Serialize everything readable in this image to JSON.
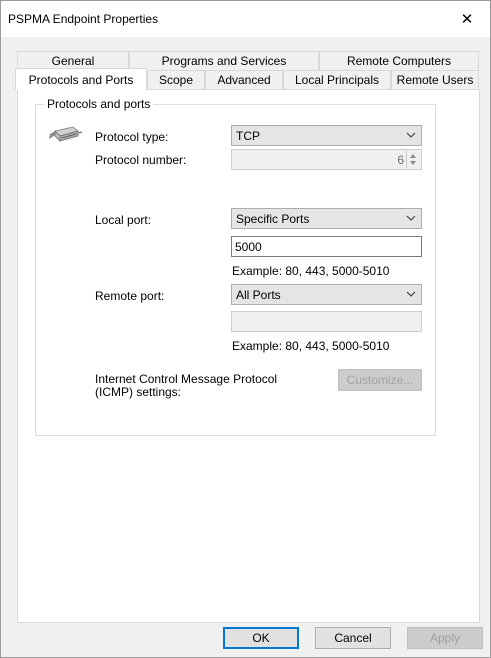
{
  "window": {
    "title": "PSPMA Endpoint Properties",
    "close_glyph": "✕"
  },
  "tabs": {
    "row1": [
      "General",
      "Programs and Services",
      "Remote Computers"
    ],
    "row2": [
      "Protocols and Ports",
      "Scope",
      "Advanced",
      "Local Principals",
      "Remote Users"
    ],
    "active": "Protocols and Ports"
  },
  "group": {
    "title": "Protocols and ports",
    "protocol_type_label": "Protocol type:",
    "protocol_type_value": "TCP",
    "protocol_number_label": "Protocol number:",
    "protocol_number_value": "6",
    "local_port_label": "Local port:",
    "local_port_value": "Specific Ports",
    "local_port_text": "5000",
    "local_example": "Example: 80, 443, 5000-5010",
    "remote_port_label": "Remote port:",
    "remote_port_value": "All Ports",
    "remote_port_text": "",
    "remote_example": "Example: 80, 443, 5000-5010",
    "icmp_label_line1": "Internet Control Message Protocol",
    "icmp_label_line2": "(ICMP) settings:",
    "customize_button": "Customize..."
  },
  "footer": {
    "ok": "OK",
    "cancel": "Cancel",
    "apply": "Apply"
  },
  "icons": {
    "protocol": "network-plug-icon",
    "dropdown": "chevron-down-icon",
    "spinner": "spin-arrows-icon"
  }
}
